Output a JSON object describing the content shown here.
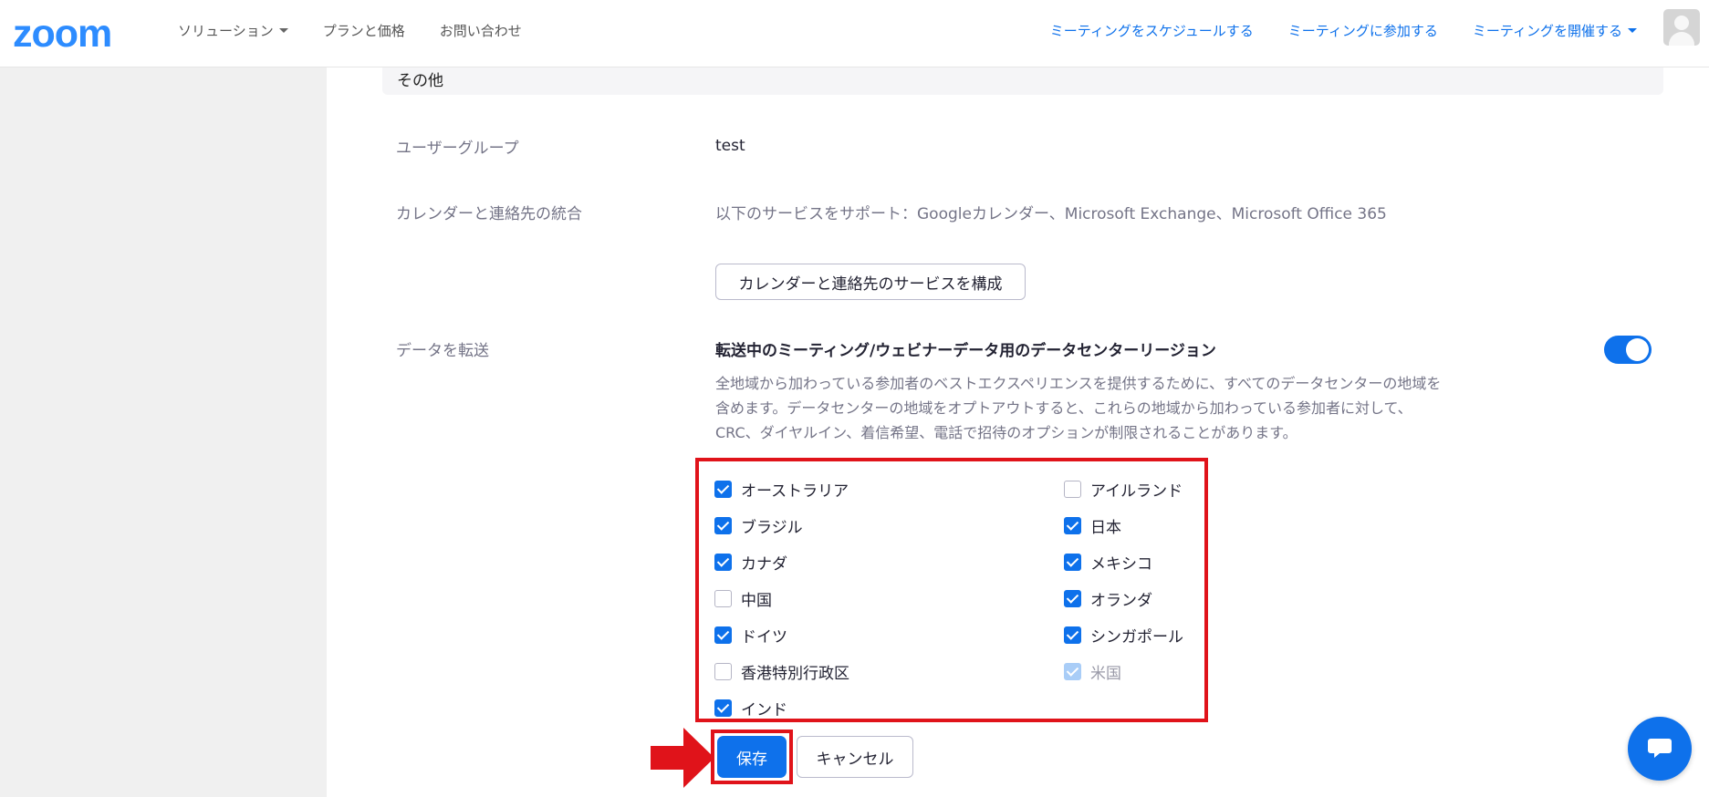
{
  "header": {
    "logo": "zoom",
    "nav_left": [
      {
        "label": "ソリューション",
        "dropdown": true
      },
      {
        "label": "プランと価格",
        "dropdown": false
      },
      {
        "label": "お問い合わせ",
        "dropdown": false
      }
    ],
    "nav_right": [
      {
        "label": "ミーティングをスケジュールする",
        "dropdown": false
      },
      {
        "label": "ミーティングに参加する",
        "dropdown": false
      },
      {
        "label": "ミーティングを開催する",
        "dropdown": true
      }
    ]
  },
  "section": {
    "title": "その他"
  },
  "rows": {
    "user_group": {
      "label": "ユーザーグループ",
      "value": "test"
    },
    "calendar": {
      "label": "カレンダーと連絡先の統合",
      "value": "以下のサービスをサポート：Googleカレンダー、Microsoft Exchange、Microsoft Office 365",
      "button": "カレンダーと連絡先のサービスを構成"
    },
    "data_transfer": {
      "label": "データを転送",
      "setting_title": "転送中のミーティング/ウェビナーデータ用のデータセンターリージョン",
      "desc_lines": [
        "全地域から加わっている参加者のベストエクスペリエンスを提供するために、すべてのデータセンターの地域を",
        "含めます。データセンターの地域をオプトアウトすると、これらの地域から加わっている参加者に対して、",
        "CRC、ダイヤルイン、着信希望、電話で招待のオプションが制限されることがあります。"
      ],
      "toggle_on": true
    }
  },
  "regions": {
    "left": [
      {
        "label": "オーストラリア",
        "state": "checked"
      },
      {
        "label": "ブラジル",
        "state": "checked"
      },
      {
        "label": "カナダ",
        "state": "checked"
      },
      {
        "label": "中国",
        "state": "unchecked"
      },
      {
        "label": "ドイツ",
        "state": "checked"
      },
      {
        "label": "香港特別行政区",
        "state": "unchecked"
      },
      {
        "label": "インド",
        "state": "checked"
      }
    ],
    "right": [
      {
        "label": "アイルランド",
        "state": "unchecked"
      },
      {
        "label": "日本",
        "state": "checked"
      },
      {
        "label": "メキシコ",
        "state": "checked"
      },
      {
        "label": "オランダ",
        "state": "checked"
      },
      {
        "label": "シンガポール",
        "state": "checked"
      },
      {
        "label": "米国",
        "state": "disabled"
      }
    ]
  },
  "actions": {
    "save": "保存",
    "cancel": "キャンセル"
  },
  "colors": {
    "brand": "#0e71eb",
    "highlight": "#e0131a"
  }
}
